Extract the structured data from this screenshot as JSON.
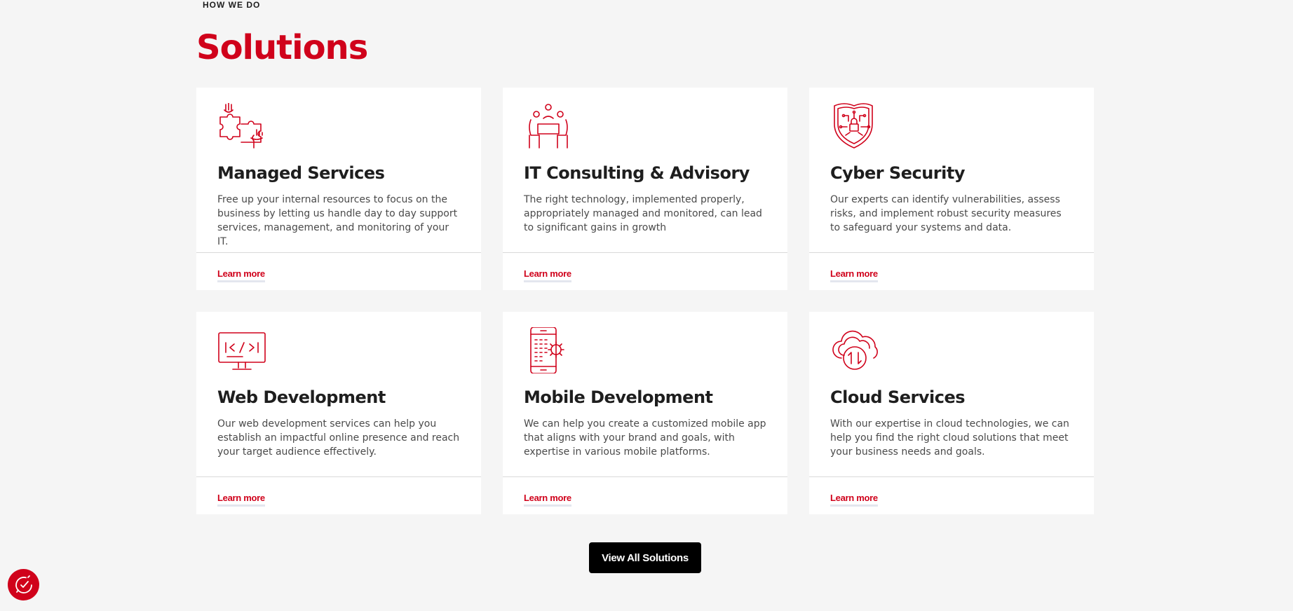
{
  "section": {
    "eyebrow": "HOW WE DO",
    "title": "Solutions"
  },
  "colors": {
    "accent": "#d0021b",
    "background": "#f5f5f5",
    "card": "#ffffff",
    "button": "#000000"
  },
  "cards": [
    {
      "icon": "puzzle-hands-icon",
      "title": "Managed Services",
      "description": "Free up your internal resources to focus on the business by letting us handle day to day support services, management, and monitoring of your IT.",
      "link": "Learn more"
    },
    {
      "icon": "meeting-table-icon",
      "title": "IT Consulting & Advisory",
      "description": "The right technology, implemented properly, appropriately managed and monitored, can lead to significant gains in growth",
      "link": "Learn more"
    },
    {
      "icon": "security-shield-icon",
      "title": "Cyber Security",
      "description": "Our experts can identify vulnerabilities, assess risks, and implement robust security measures to safeguard your systems and data.",
      "link": "Learn more"
    },
    {
      "icon": "code-monitor-icon",
      "title": "Web Development",
      "description": "Our web development services can help you establish an impactful online presence and reach your target audience effectively.",
      "link": "Learn more"
    },
    {
      "icon": "mobile-gear-icon",
      "title": "Mobile Development",
      "description": "We can help you create a customized mobile app that aligns with your brand and goals, with expertise in various mobile platforms.",
      "link": "Learn more"
    },
    {
      "icon": "cloud-transfer-icon",
      "title": "Cloud Services",
      "description": "With our expertise in cloud technologies, we can help you find the right cloud solutions that meet your business needs and goals.",
      "link": "Learn more"
    }
  ],
  "cta": {
    "label": "View All Solutions"
  },
  "cookie": {
    "icon": "cookie-consent-icon"
  }
}
